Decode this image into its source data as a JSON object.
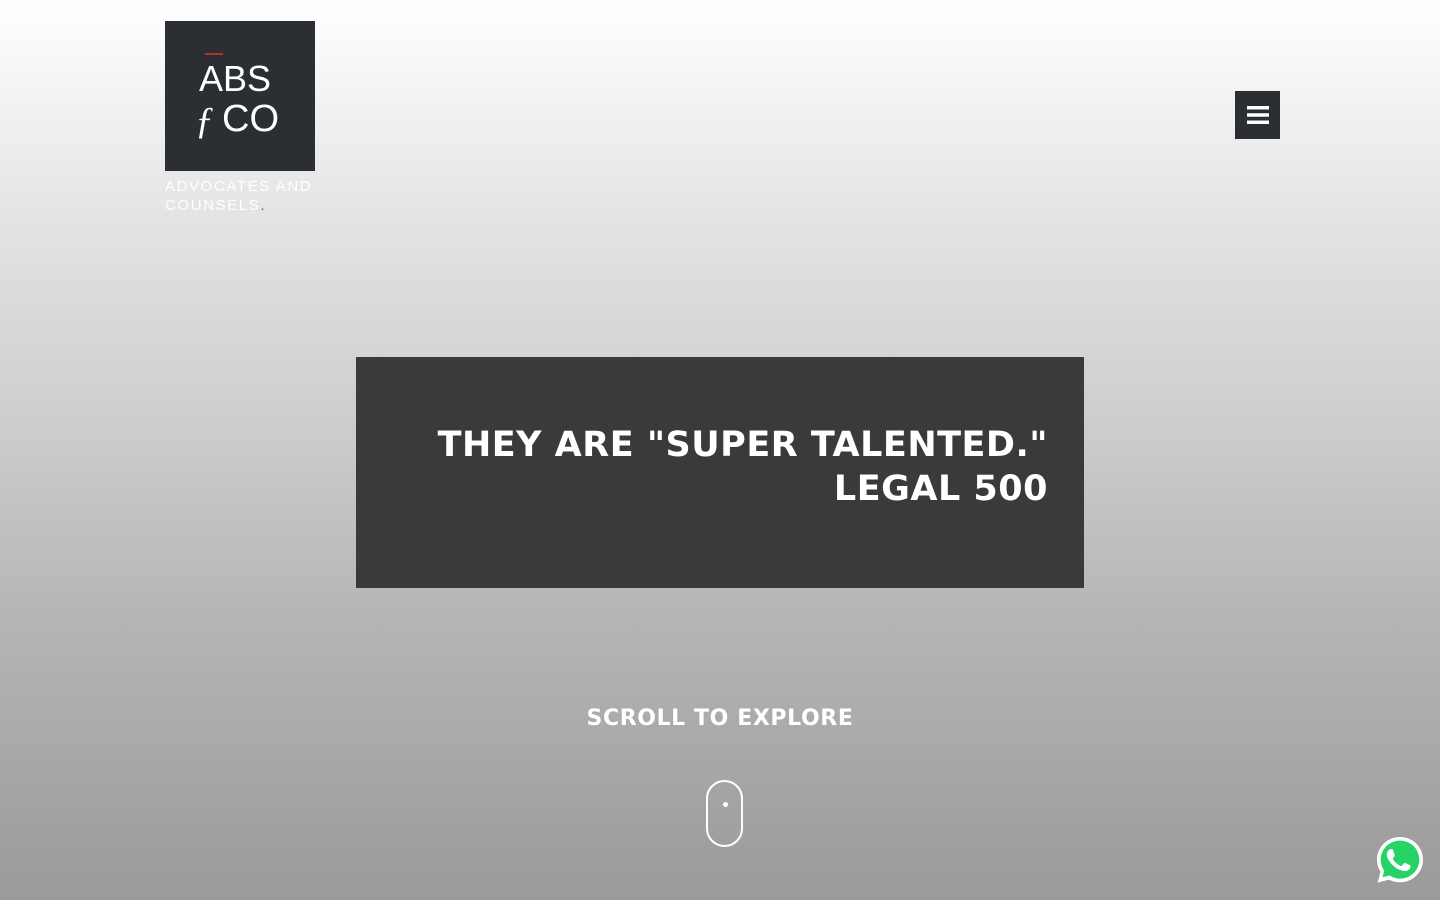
{
  "brand": {
    "logo_line1": "ABS",
    "logo_line2": "CO",
    "tagline_line1": "ADVOCATES AND",
    "tagline_line2": "COUNSELS",
    "tagline_dot": ".",
    "accent_color": "#e0322e",
    "box_color": "#2b2e33"
  },
  "header": {
    "menu_icon": "hamburger-icon"
  },
  "hero": {
    "quote_line1": "THEY ARE \"SUPER TALENTED.\"",
    "quote_line2": "LEGAL 500",
    "quote_bg_color": "#3a3a3d"
  },
  "scroll": {
    "label": "SCROLL TO EXPLORE",
    "icon": "mouse-scroll-icon"
  },
  "floating": {
    "whatsapp_icon": "whatsapp-icon",
    "whatsapp_color": "#25d366"
  }
}
